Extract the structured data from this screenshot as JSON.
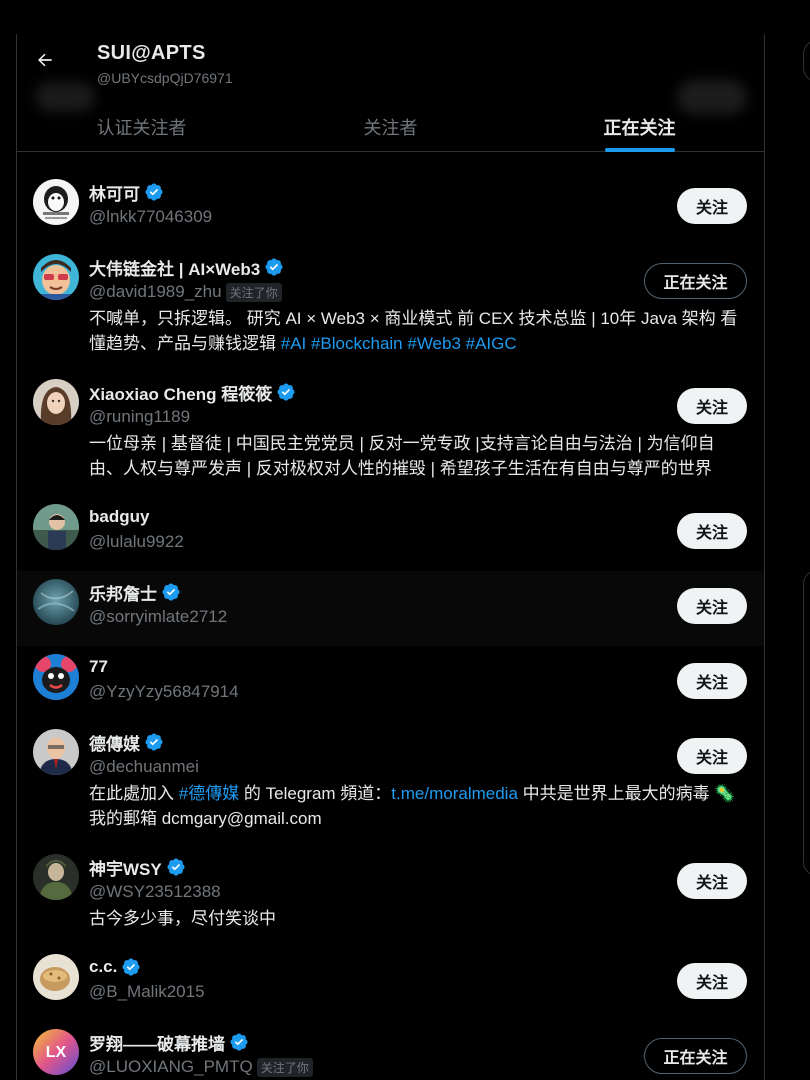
{
  "profile": {
    "name": "SUI@APTS",
    "handle": "@UBYcsdpQjD76971"
  },
  "tabs": [
    {
      "label": "认证关注者",
      "active": false
    },
    {
      "label": "关注者",
      "active": false
    },
    {
      "label": "正在关注",
      "active": true
    }
  ],
  "colors": {
    "accent": "#1d9bf0",
    "background": "#000000",
    "muted": "#71767b"
  },
  "users": [
    {
      "name": "林可可",
      "handle": "@lnkk77046309",
      "verified": true,
      "follows_you": "",
      "button": "关注",
      "bio_text_1": "",
      "bio_link_1": "",
      "bio_text_2": "",
      "bio_link_2": "",
      "bio_text_3": ""
    },
    {
      "name": "大伟链金社 | AI×Web3",
      "handle": "@david1989_zhu",
      "verified": true,
      "follows_you": "关注了你",
      "button": "正在关注",
      "bio_text_1": "不喊单，只拆逻辑。 研究 AI × Web3 × 商业模式 前 CEX 技术总监 | 10年 Java 架构 看懂趋势、产品与赚钱逻辑 ",
      "bio_link_1": "#AI #Blockchain #Web3 #AIGC",
      "bio_text_2": "",
      "bio_link_2": "",
      "bio_text_3": ""
    },
    {
      "name": "Xiaoxiao Cheng 程筱筱",
      "handle": "@runing1189",
      "verified": true,
      "follows_you": "",
      "button": "关注",
      "bio_text_1": "一位母亲 | 基督徒 | 中国民主党党员 | 反对一党专政 |支持言论自由与法治 | 为信仰自由、人权与尊严发声 | 反对极权对人性的摧毁 | 希望孩子生活在有自由与尊严的世界",
      "bio_link_1": "",
      "bio_text_2": "",
      "bio_link_2": "",
      "bio_text_3": ""
    },
    {
      "name": "badguy",
      "handle": "@lulalu9922",
      "verified": false,
      "follows_you": "",
      "button": "关注",
      "bio_text_1": "",
      "bio_link_1": "",
      "bio_text_2": "",
      "bio_link_2": "",
      "bio_text_3": ""
    },
    {
      "name": "乐邦詹士",
      "handle": "@sorryimlate2712",
      "verified": true,
      "follows_you": "",
      "button": "关注",
      "bio_text_1": "",
      "bio_link_1": "",
      "bio_text_2": "",
      "bio_link_2": "",
      "bio_text_3": ""
    },
    {
      "name": "77",
      "handle": "@YzyYzy56847914",
      "verified": false,
      "follows_you": "",
      "button": "关注",
      "bio_text_1": "",
      "bio_link_1": "",
      "bio_text_2": "",
      "bio_link_2": "",
      "bio_text_3": ""
    },
    {
      "name": "德傳媒",
      "handle": "@dechuanmei",
      "verified": true,
      "follows_you": "",
      "button": "关注",
      "bio_text_1": "在此處加入 ",
      "bio_link_1": "#德傳媒",
      "bio_text_2": " 的 Telegram 頻道：",
      "bio_link_2": "t.me/moralmedia",
      "bio_text_3": " 中共是世界上最大的病毒 🦠 我的郵箱 dcmgary@gmail.com"
    },
    {
      "name": "神宇WSY",
      "handle": "@WSY23512388",
      "verified": true,
      "follows_you": "",
      "button": "关注",
      "bio_text_1": "古今多少事，尽付笑谈中",
      "bio_link_1": "",
      "bio_text_2": "",
      "bio_link_2": "",
      "bio_text_3": ""
    },
    {
      "name": "c.c.",
      "handle": "@B_Malik2015",
      "verified": true,
      "follows_you": "",
      "button": "关注",
      "bio_text_1": "",
      "bio_link_1": "",
      "bio_text_2": "",
      "bio_link_2": "",
      "bio_text_3": ""
    },
    {
      "name": "罗翔——破幕推墙",
      "handle": "@LUOXIANG_PMTQ",
      "verified": true,
      "follows_you": "关注了你",
      "button": "正在关注",
      "bio_text_1": "",
      "bio_link_1": "",
      "bio_text_2": "",
      "bio_link_2": "",
      "bio_text_3": "",
      "avatar_text": "LX"
    }
  ]
}
